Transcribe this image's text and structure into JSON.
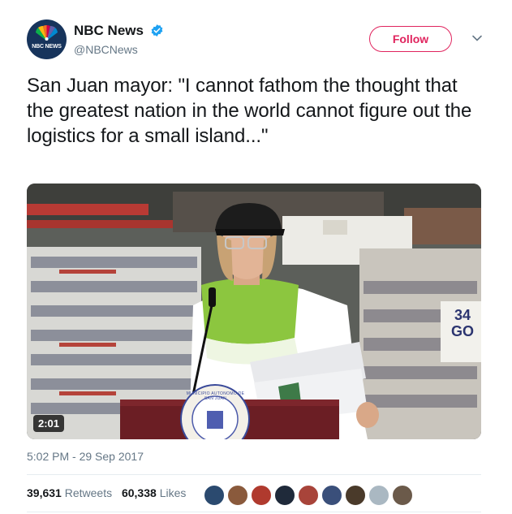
{
  "author": {
    "avatar_text": "NBC NEWS",
    "display_name": "NBC News",
    "handle": "@NBCNews",
    "verified": true
  },
  "actions": {
    "follow_label": "Follow"
  },
  "tweet": {
    "text": "San Juan mayor: \"I cannot fathom the thought that the greatest nation in the world cannot figure out the logistics for a small island...\"",
    "timestamp": "5:02 PM - 29 Sep 2017"
  },
  "media": {
    "type": "video",
    "duration": "2:01",
    "sign_text": "34",
    "sign_text2": "GO",
    "seal_text": "MUNICIPIO AUTONOMO DE SAN JUAN"
  },
  "stats": {
    "retweets_count": "39,631",
    "retweets_label": "Retweets",
    "likes_count": "60,338",
    "likes_label": "Likes"
  },
  "likers": [
    {
      "name": "liker-1",
      "color": "#2b4a6f"
    },
    {
      "name": "liker-2",
      "color": "#8a5a3c"
    },
    {
      "name": "liker-3",
      "color": "#b03a2e"
    },
    {
      "name": "liker-4",
      "color": "#1f2a3a"
    },
    {
      "name": "liker-5",
      "color": "#a8443a"
    },
    {
      "name": "liker-6",
      "color": "#3a4f7a"
    },
    {
      "name": "liker-7",
      "color": "#4a3a2a"
    },
    {
      "name": "liker-8",
      "color": "#aab8c2"
    },
    {
      "name": "liker-9",
      "color": "#6b5a4a"
    }
  ],
  "colors": {
    "accent": "#e0245e",
    "verified": "#1da1f2",
    "secondary_text": "#657786"
  }
}
